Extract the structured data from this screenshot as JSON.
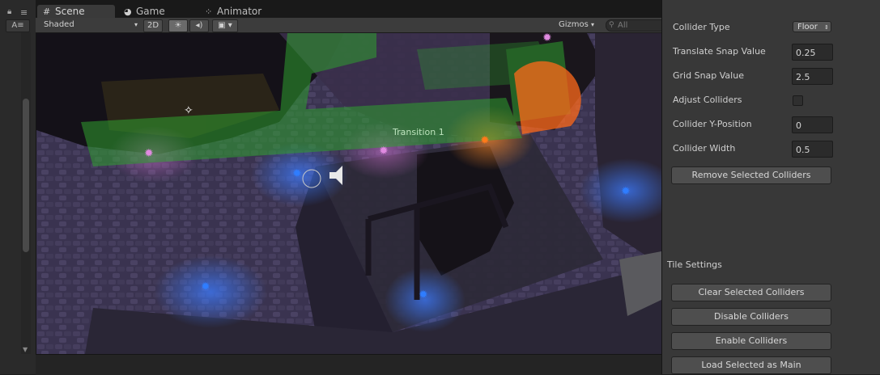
{
  "tabs": [
    {
      "label": "Scene",
      "icon": "grid-icon"
    },
    {
      "label": "Game",
      "icon": "pacman-icon"
    },
    {
      "label": "Animator",
      "icon": "animator-icon"
    }
  ],
  "toolbar": {
    "shading_mode": "Shaded",
    "mode_2d": "2D",
    "gizmos": "Gizmos",
    "search_placeholder": "All"
  },
  "scene": {
    "transition_label": "Transition 1"
  },
  "inspector": {
    "collider_type": {
      "label": "Collider Type",
      "value": "Floor"
    },
    "translate_snap": {
      "label": "Translate Snap Value",
      "value": "0.25"
    },
    "grid_snap": {
      "label": "Grid Snap Value",
      "value": "2.5"
    },
    "adjust_colliders": {
      "label": "Adjust Colliders",
      "checked": false
    },
    "collider_y": {
      "label": "Collider Y-Position",
      "value": "0"
    },
    "collider_width": {
      "label": "Collider Width",
      "value": "0.5"
    },
    "remove_button": "Remove Selected Colliders",
    "tile_settings_title": "Tile Settings",
    "clear_button": "Clear Selected Colliders",
    "disable_button": "Disable Colliders",
    "enable_button": "Enable Colliders",
    "load_button": "Load Selected as Main"
  },
  "colors": {
    "light_blue": "#2f7dff",
    "light_pink": "#e08ae0",
    "light_orange": "#ff7a1a",
    "collider_green": "#2fa02f"
  }
}
